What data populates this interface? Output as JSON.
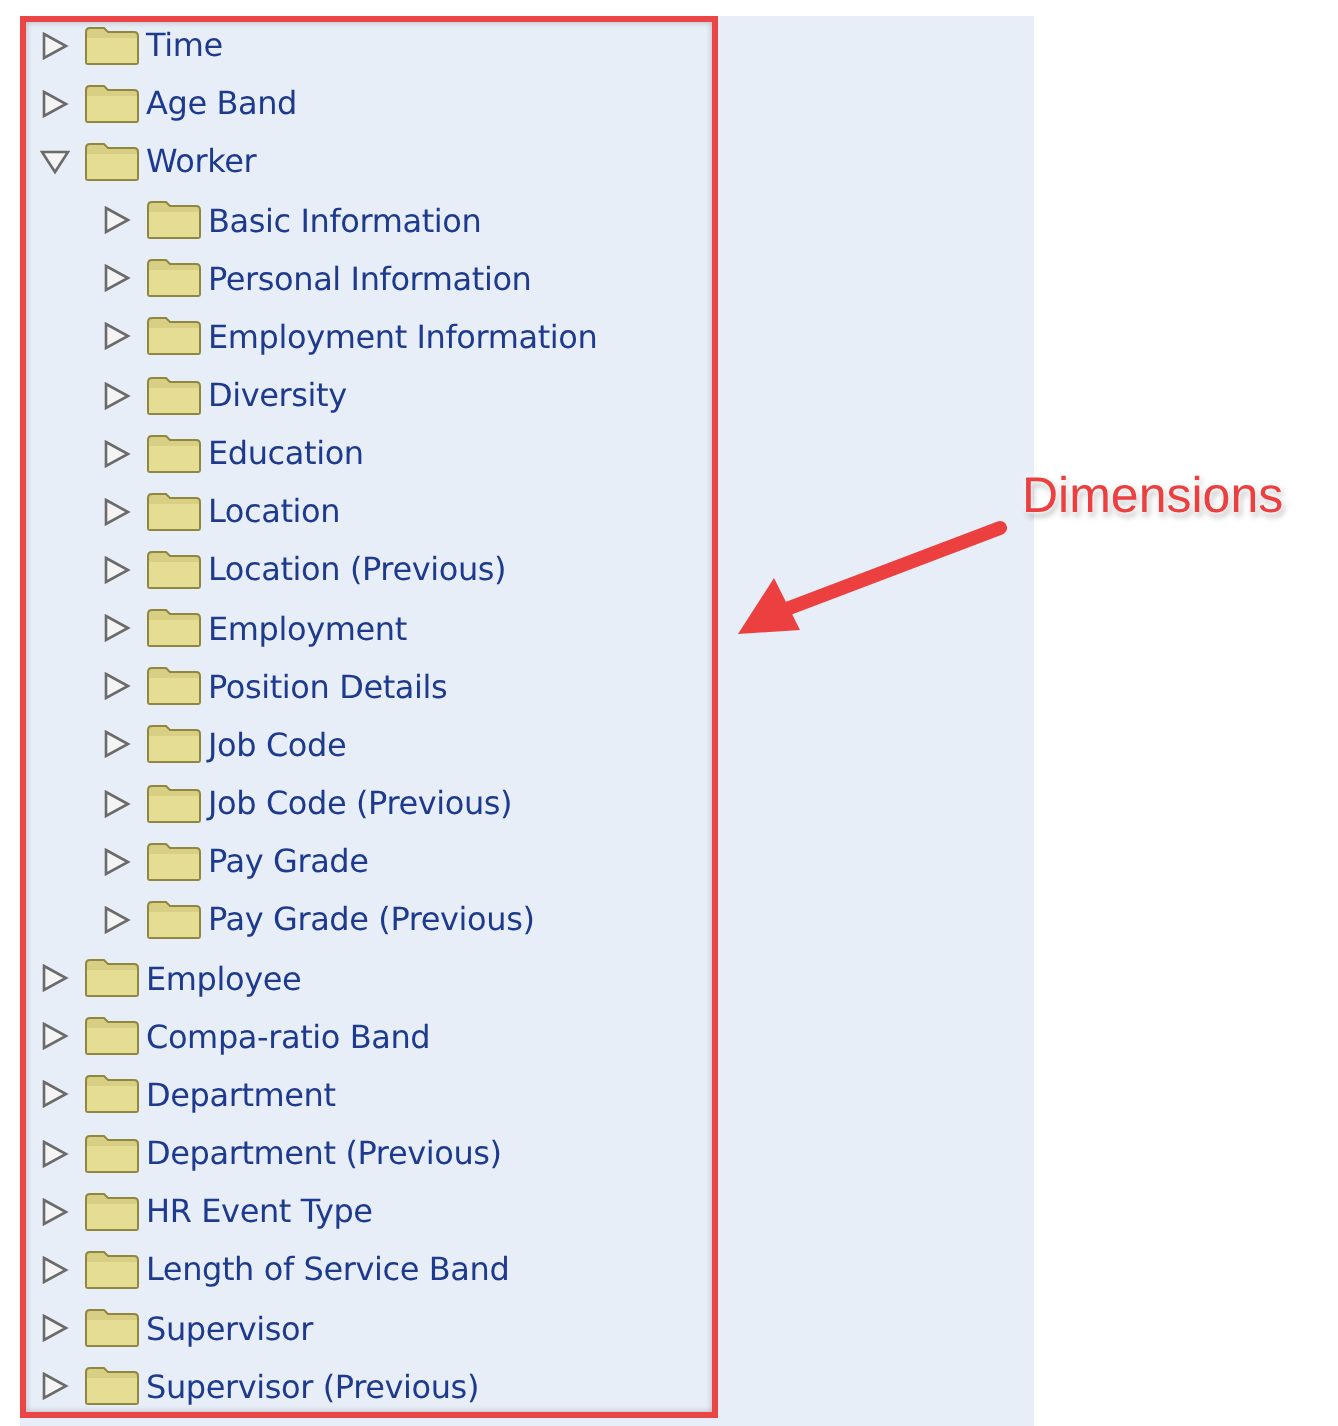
{
  "tree": [
    {
      "label": "Time",
      "expanded": false
    },
    {
      "label": "Age Band",
      "expanded": false
    },
    {
      "label": "Worker",
      "expanded": true,
      "children": [
        {
          "label": "Basic Information",
          "expanded": false
        },
        {
          "label": "Personal Information",
          "expanded": false
        },
        {
          "label": "Employment Information",
          "expanded": false
        },
        {
          "label": "Diversity",
          "expanded": false
        },
        {
          "label": "Education",
          "expanded": false
        },
        {
          "label": "Location",
          "expanded": false
        },
        {
          "label": "Location (Previous)",
          "expanded": false
        },
        {
          "label": "Employment",
          "expanded": false
        },
        {
          "label": "Position Details",
          "expanded": false
        },
        {
          "label": "Job Code",
          "expanded": false
        },
        {
          "label": "Job Code (Previous)",
          "expanded": false
        },
        {
          "label": "Pay Grade",
          "expanded": false
        },
        {
          "label": "Pay Grade (Previous)",
          "expanded": false
        }
      ]
    },
    {
      "label": "Employee",
      "expanded": false
    },
    {
      "label": "Compa-ratio Band",
      "expanded": false
    },
    {
      "label": "Department",
      "expanded": false
    },
    {
      "label": "Department (Previous)",
      "expanded": false
    },
    {
      "label": "HR Event Type",
      "expanded": false
    },
    {
      "label": "Length of Service Band",
      "expanded": false
    },
    {
      "label": "Supervisor",
      "expanded": false
    },
    {
      "label": "Supervisor (Previous)",
      "expanded": false
    }
  ],
  "annotation": {
    "label": "Dimensions"
  }
}
